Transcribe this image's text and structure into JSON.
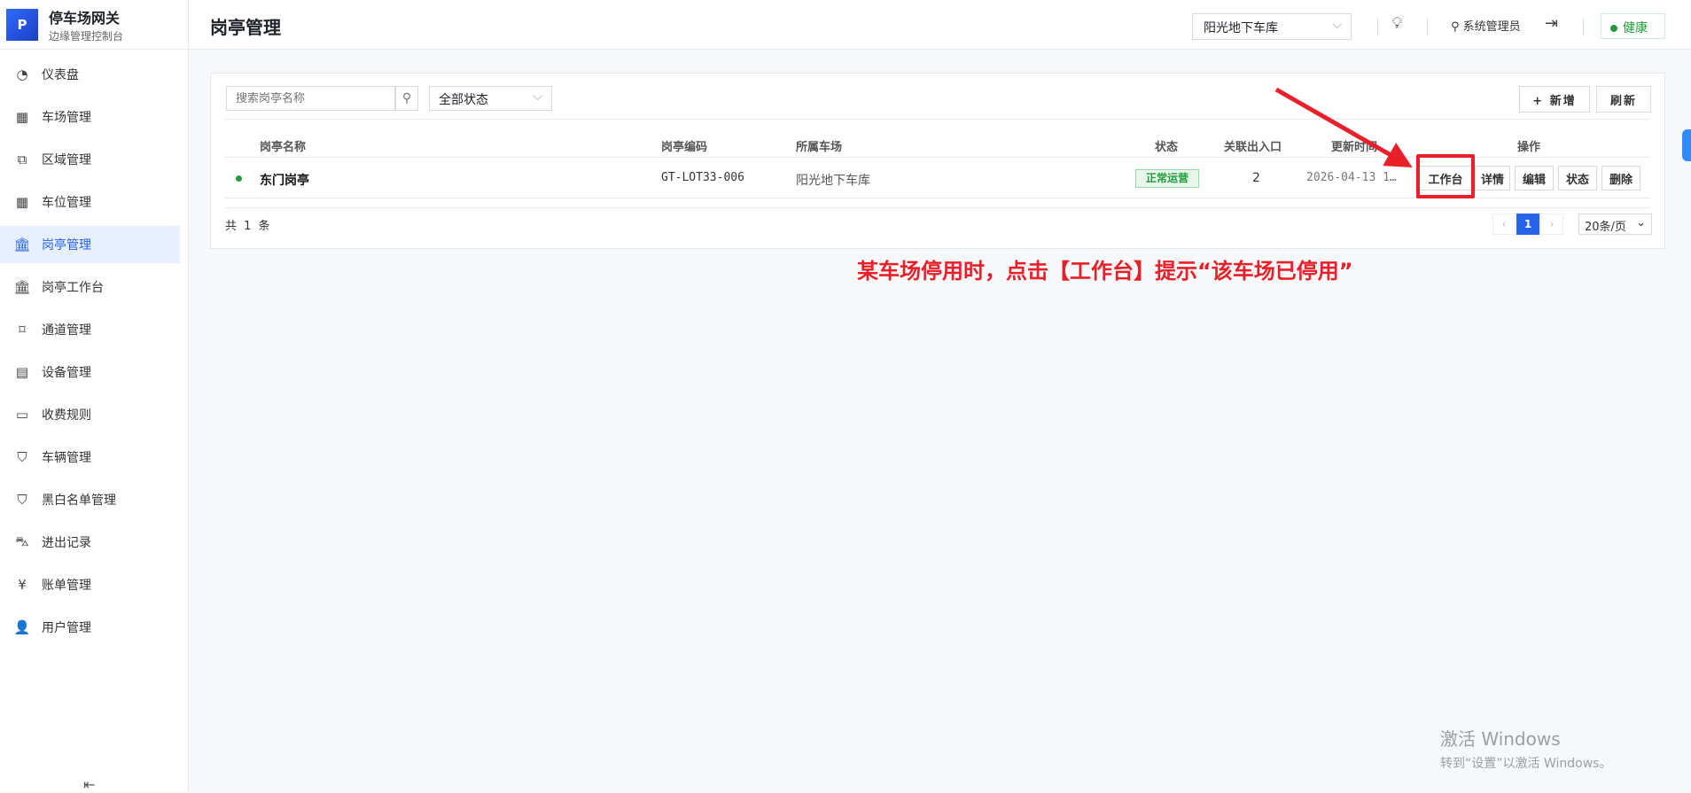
{
  "brand": {
    "logo": "P",
    "title": "停车场网关",
    "subtitle": "边缘管理控制台"
  },
  "sidebar": {
    "items": [
      {
        "label": "仪表盘",
        "icon": "dashboard-icon",
        "glyph": "◔"
      },
      {
        "label": "车场管理",
        "icon": "grid-icon",
        "glyph": "▦"
      },
      {
        "label": "区域管理",
        "icon": "layers-icon",
        "glyph": "⧉"
      },
      {
        "label": "车位管理",
        "icon": "table-icon",
        "glyph": "▦"
      },
      {
        "label": "岗亭管理",
        "icon": "bank-icon",
        "glyph": "🏛",
        "active": true
      },
      {
        "label": "岗亭工作台",
        "icon": "bank-icon",
        "glyph": "🏛"
      },
      {
        "label": "通道管理",
        "icon": "channel-icon",
        "glyph": "⌑"
      },
      {
        "label": "设备管理",
        "icon": "device-icon",
        "glyph": "▤"
      },
      {
        "label": "收费规则",
        "icon": "wallet-icon",
        "glyph": "▭"
      },
      {
        "label": "车辆管理",
        "icon": "shield-icon",
        "glyph": "⛉"
      },
      {
        "label": "黑白名单管理",
        "icon": "shield-icon",
        "glyph": "⛉"
      },
      {
        "label": "进出记录",
        "icon": "car-icon",
        "glyph": "⛍"
      },
      {
        "label": "账单管理",
        "icon": "bill-icon",
        "glyph": "¥"
      },
      {
        "label": "用户管理",
        "icon": "user-icon",
        "glyph": "👤"
      }
    ],
    "collapse_glyph": "⇤"
  },
  "header": {
    "title": "岗亭管理",
    "lot_select": "阳光地下车库",
    "user": "系统管理员",
    "health": "健康"
  },
  "toolbar": {
    "search_placeholder": "搜索岗亭名称",
    "status_select": "全部状态",
    "add": "+ 新增",
    "refresh": "刷新"
  },
  "table": {
    "headers": [
      "岗亭名称",
      "岗亭编码",
      "所属车场",
      "状态",
      "关联出入口",
      "更新时间",
      "操作"
    ],
    "rows": [
      {
        "name": "东门岗亭",
        "code": "GT-LOT33-006",
        "lot": "阳光地下车库",
        "status": "正常运营",
        "ports": "2",
        "updated": "2026-04-13 1…",
        "actions": [
          "工作台",
          "详情",
          "编辑",
          "状态",
          "删除"
        ]
      }
    ]
  },
  "pagination": {
    "total": "共 1 条",
    "prev": "‹",
    "current": "1",
    "next": "›",
    "page_size": "20条/页"
  },
  "annotation": "某车场停用时，点击【工作台】提示“该车场已停用”",
  "watermark": {
    "line1": "激活 Windows",
    "line2": "转到“设置”以激活 Windows。"
  },
  "colors": {
    "accent": "#2563eb",
    "success": "#1f9d3a",
    "annotation": "#e8202a"
  }
}
